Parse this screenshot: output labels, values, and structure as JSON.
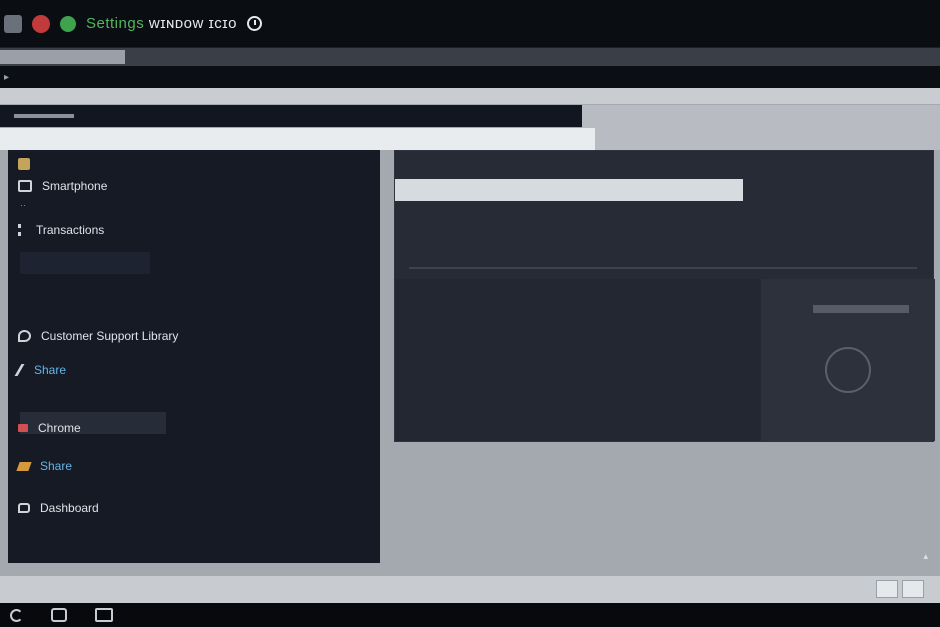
{
  "window": {
    "title_prefix": "Settings",
    "title_rest": "ᴡɪɴᴅᴏᴡ ɪᴄɪᴏ"
  },
  "tabstrip": {
    "active_tab": ""
  },
  "addressbar": {
    "text": "▸"
  },
  "left_header": {
    "label": ""
  },
  "light_strip": {
    "label": ""
  },
  "sidebar": {
    "items": [
      {
        "label": "",
        "icon": "folder-icon"
      },
      {
        "label": "Smartphone",
        "icon": "device-icon"
      },
      {
        "label": "Transactions",
        "icon": "list-icon"
      },
      {
        "label": "Customer Support Library",
        "icon": "chat-icon"
      },
      {
        "label": "Share",
        "icon": "pin-icon",
        "accent": "#66b4e6"
      },
      {
        "label": "Chrome",
        "icon": "flag-icon"
      },
      {
        "label": "Share",
        "icon": "tag-icon",
        "accent": "#66b4e6"
      },
      {
        "label": "Dashboard",
        "icon": "message-icon"
      }
    ],
    "input_line1": "",
    "input_line2": "",
    "footer": ""
  },
  "panel": {
    "title": "",
    "subtitle": "",
    "inner_label_1": "",
    "inner_label_2": "",
    "inner_label_3": "",
    "link_text": "",
    "side_button": ""
  },
  "colors": {
    "accent_blue": "#66b4e6",
    "accent_green": "#52b85c",
    "sidebar_bg": "#151a24",
    "panel_bg": "#262b35"
  }
}
